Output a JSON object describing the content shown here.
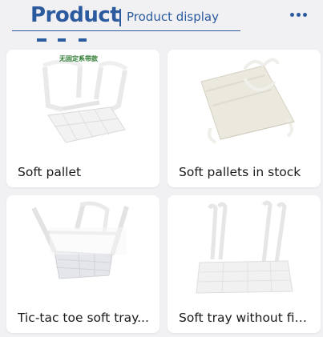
{
  "header": {
    "title": "Product",
    "subtitle": "Product display",
    "menu_icon": "more-dots-icon"
  },
  "colors": {
    "accent": "#2b5a9e",
    "card_bg": "#ffffff",
    "page_bg": "#f1f1f3"
  },
  "products": [
    {
      "label": "Soft pallet",
      "image_caption": "无固定系带款"
    },
    {
      "label": "Soft pallets in stock"
    },
    {
      "label": "Tic-tac toe soft tray..."
    },
    {
      "label": "Soft tray without fix..."
    }
  ]
}
